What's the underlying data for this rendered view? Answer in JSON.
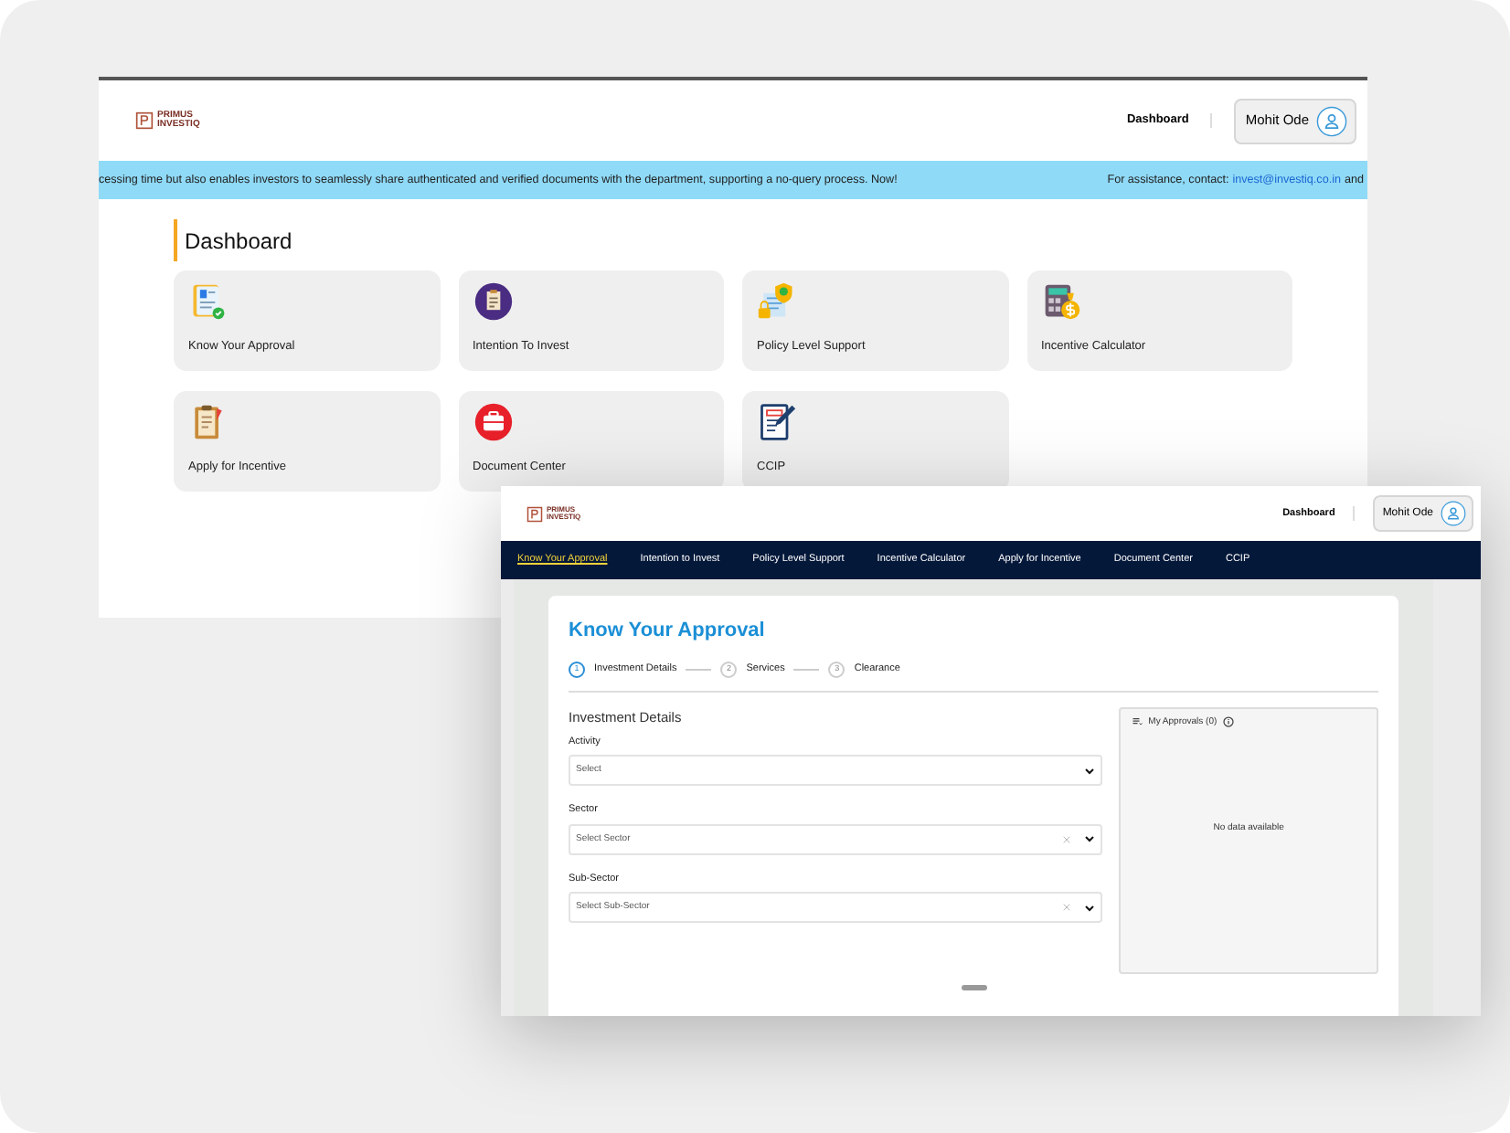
{
  "back_window": {
    "logo": {
      "line1": "PRIMUS",
      "line2": "INVESTIQ"
    },
    "nav_link": "Dashboard",
    "user": "Mohit Ode",
    "banner": {
      "message": "cessing time but also enables investors to seamlessly share authenticated and verified documents with the department, supporting a no-query process. Now!",
      "assistance": "For assistance, contact:",
      "email": "invest@investiq.co.in",
      "trail": "and"
    },
    "title": "Dashboard",
    "cards": [
      {
        "label": "Know Your Approval",
        "kind": "profile"
      },
      {
        "label": "Intention To Invest",
        "kind": "clipboard"
      },
      {
        "label": "Policy Level Support",
        "kind": "shield"
      },
      {
        "label": "Incentive Calculator",
        "kind": "calculator"
      },
      {
        "label": "Apply for Incentive",
        "kind": "notepad"
      },
      {
        "label": "Document Center",
        "kind": "briefcase"
      },
      {
        "label": "CCIP",
        "kind": "form"
      }
    ]
  },
  "front_window": {
    "logo": {
      "line1": "PRIMUS",
      "line2": "INVESTIQ"
    },
    "nav_link": "Dashboard",
    "user": "Mohit Ode",
    "menu": [
      {
        "label": "Know Your Approval",
        "selected": true
      },
      {
        "label": "Intention to Invest",
        "selected": false
      },
      {
        "label": "Policy Level Support",
        "selected": false
      },
      {
        "label": "Incentive Calculator",
        "selected": false
      },
      {
        "label": "Apply for Incentive",
        "selected": false
      },
      {
        "label": "Document Center",
        "selected": false
      },
      {
        "label": "CCIP",
        "selected": false
      }
    ],
    "title": "Know Your Approval",
    "steps": [
      {
        "number": "1",
        "label": "Investment Details",
        "selected": true
      },
      {
        "number": "2",
        "label": "Services",
        "selected": false
      },
      {
        "number": "3",
        "label": "Clearance",
        "selected": false
      }
    ],
    "section_title": "Investment Details",
    "fields": [
      {
        "label": "Activity",
        "placeholder": "Select",
        "clearable": false
      },
      {
        "label": "Sector",
        "placeholder": "Select Sector",
        "clearable": true
      },
      {
        "label": "Sub-Sector",
        "placeholder": "Select Sub-Sector",
        "clearable": true
      }
    ],
    "approvals_panel": {
      "title": "My Approvals (0)",
      "empty_text": "No data available"
    }
  }
}
